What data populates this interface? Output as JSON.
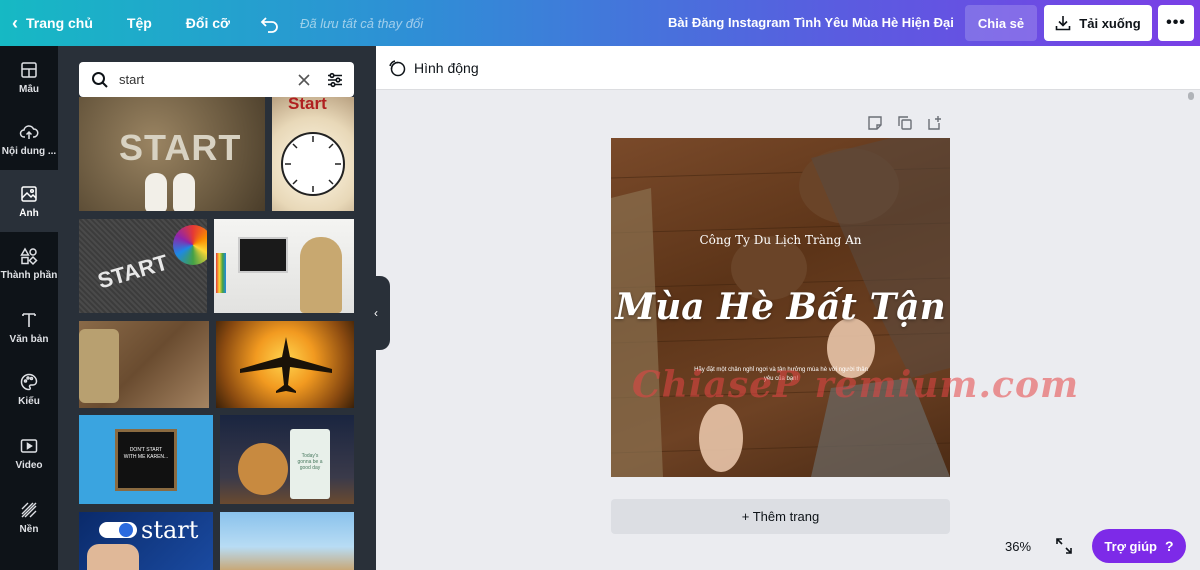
{
  "topbar": {
    "home": "Trang chủ",
    "file": "Tệp",
    "resize": "Đổi cỡ",
    "saved_status": "Đã lưu tất cả thay đổi",
    "document_title": "Bài Đăng Instagram Tình Yêu Mùa Hè Hiện Đại",
    "share": "Chia sẻ",
    "download": "Tải xuống",
    "more": "•••"
  },
  "rail": {
    "items": [
      {
        "label": "Mẫu",
        "icon": "template-icon"
      },
      {
        "label": "Nội dung ...",
        "icon": "upload-cloud-icon"
      },
      {
        "label": "Ảnh",
        "icon": "image-icon"
      },
      {
        "label": "Thành phần",
        "icon": "elements-icon"
      },
      {
        "label": "Văn bản",
        "icon": "text-icon"
      },
      {
        "label": "Kiểu",
        "icon": "palette-icon"
      },
      {
        "label": "Video",
        "icon": "video-icon"
      },
      {
        "label": "Nền",
        "icon": "background-icon"
      }
    ],
    "active_index": 2
  },
  "panel": {
    "search": {
      "value": "start"
    },
    "thumbnails": [
      {
        "text": "START"
      },
      {
        "text": "Start"
      },
      {
        "text": "START"
      },
      {
        "text": ""
      },
      {
        "text": ""
      },
      {
        "text": ""
      },
      {
        "text": "DON'T START WITH ME KAREN..."
      },
      {
        "text": "Today's gonna be a good day"
      },
      {
        "text": "start"
      },
      {
        "text": ""
      }
    ]
  },
  "editor": {
    "animate": "Hình động",
    "add_page": "+ Thêm trang",
    "zoom": "36%",
    "help": "Trợ giúp",
    "help_mark": "?"
  },
  "design": {
    "company": "Công Ty Du Lịch Tràng An",
    "headline": "Mùa Hè Bất Tận",
    "body": "Hãy đặt một chân nghỉ ngơi và tận hưởng mùa hè với người thân yêu của bạn!"
  },
  "watermark": "ChiaseP remium.com",
  "colors": {
    "rail_bg": "#0e1318",
    "panel_bg": "#293039",
    "help_purple": "#7d2ae8",
    "canvas_bg": "#ebecf0"
  }
}
